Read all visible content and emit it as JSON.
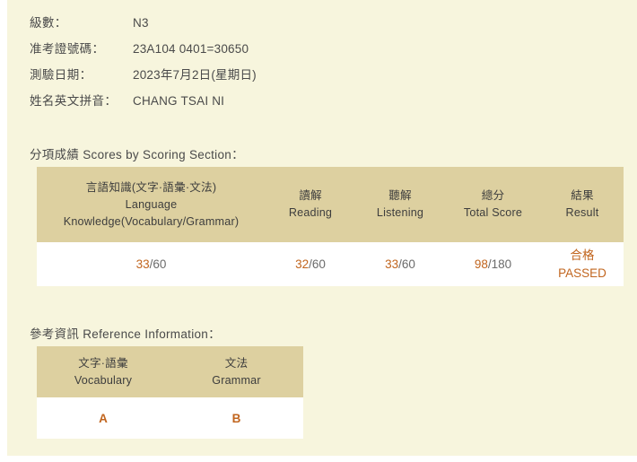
{
  "colors": {
    "page_background": "#f7f5dd",
    "table_header": "#ddd0a0",
    "table_body": "#ffffff",
    "accent": "#c1651e",
    "text": "#4a4a4a"
  },
  "info": {
    "rows": [
      {
        "label": "級數：",
        "value": "N3"
      },
      {
        "label": "准考證號碼：",
        "value": "23A104 0401=30650"
      },
      {
        "label": "測驗日期：",
        "value": "2023年7月2日(星期日)"
      },
      {
        "label": "姓名英文拼音：",
        "value": "CHANG TSAI NI"
      }
    ]
  },
  "scores_section": {
    "title": "分項成績 Scores by Scoring Section：",
    "columns": [
      {
        "cn": "言語知識(文字·語彙·文法)",
        "en_line1": "Language",
        "en_line2": "Knowledge(Vocabulary/Grammar)"
      },
      {
        "cn": "讀解",
        "en_line1": "Reading",
        "en_line2": ""
      },
      {
        "cn": "聽解",
        "en_line1": "Listening",
        "en_line2": ""
      },
      {
        "cn": "總分",
        "en_line1": "Total Score",
        "en_line2": ""
      },
      {
        "cn": "結果",
        "en_line1": "Result",
        "en_line2": ""
      }
    ],
    "values": {
      "language_knowledge_score": "33",
      "language_knowledge_max": "/60",
      "reading_score": "32",
      "reading_max": "/60",
      "listening_score": "33",
      "listening_max": "/60",
      "total_score": "98",
      "total_max": "/180",
      "result_cn": "合格",
      "result_en": "PASSED"
    }
  },
  "reference_section": {
    "title": "參考資訊 Reference Information：",
    "columns": [
      {
        "cn": "文字·語彙",
        "en": "Vocabulary"
      },
      {
        "cn": "文法",
        "en": "Grammar"
      }
    ],
    "values": {
      "vocabulary_grade": "A",
      "grammar_grade": "B"
    }
  }
}
